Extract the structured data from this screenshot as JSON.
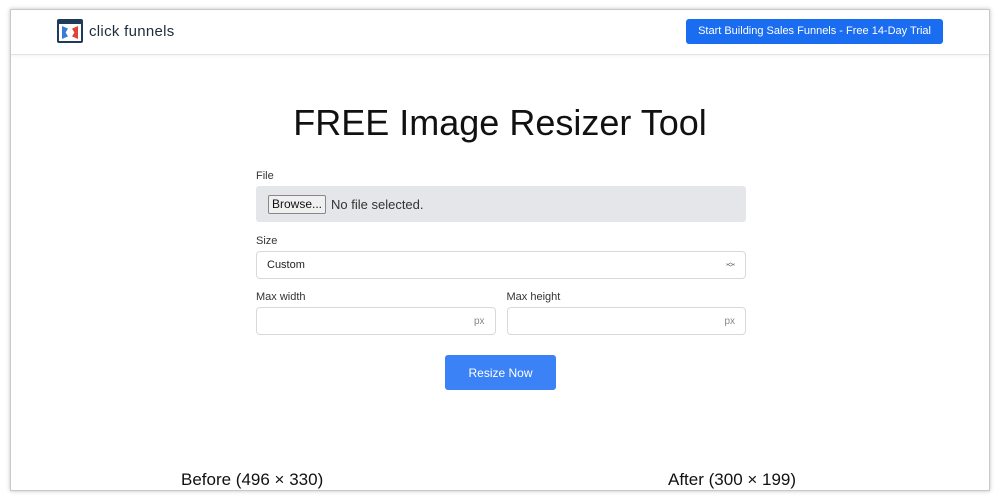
{
  "header": {
    "logo_text": "click funnels",
    "cta_label": "Start Building Sales Funnels - Free 14-Day Trial"
  },
  "title": "FREE Image Resizer Tool",
  "form": {
    "file_label": "File",
    "browse_label": "Browse...",
    "file_status": "No file selected.",
    "size_label": "Size",
    "size_value": "Custom",
    "max_width_label": "Max width",
    "max_height_label": "Max height",
    "unit": "px",
    "resize_label": "Resize Now"
  },
  "preview": {
    "before": "Before (496 × 330)",
    "after": "After (300 × 199)"
  }
}
